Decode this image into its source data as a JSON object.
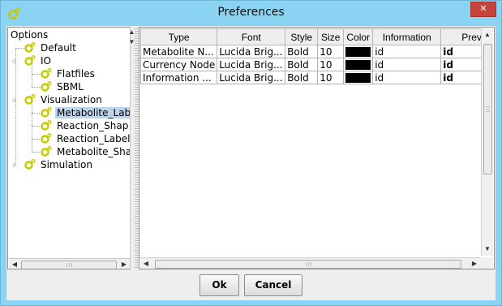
{
  "window": {
    "title": "Preferences",
    "close_label": "✕"
  },
  "tree": {
    "root": "Options",
    "items": [
      {
        "label": "Default"
      },
      {
        "label": "IO"
      },
      {
        "label": "Flatfiles"
      },
      {
        "label": "SBML"
      },
      {
        "label": "Visualization"
      },
      {
        "label": "Metabolite_Labe"
      },
      {
        "label": "Reaction_Shap"
      },
      {
        "label": "Reaction_Label"
      },
      {
        "label": "Metabolite_Sha"
      },
      {
        "label": "Simulation"
      }
    ]
  },
  "table": {
    "headers": [
      "Type",
      "Font",
      "Style",
      "Size",
      "Color",
      "Information",
      "Previe"
    ],
    "rows": [
      {
        "type": "Metabolite N...",
        "font": "Lucida Brig...",
        "style": "Bold",
        "size": "10",
        "color": "#000000",
        "information": "id",
        "preview": "id"
      },
      {
        "type": "Currency Node",
        "font": "Lucida Brig...",
        "style": "Bold",
        "size": "10",
        "color": "#000000",
        "information": "id",
        "preview": "id"
      },
      {
        "type": "Information ...",
        "font": "Lucida Brig...",
        "style": "Bold",
        "size": "10",
        "color": "#000000",
        "information": "id",
        "preview": "id"
      }
    ]
  },
  "buttons": {
    "ok": "Ok",
    "cancel": "Cancel"
  },
  "icons": {
    "app": "gear-icon",
    "tree_node": "gear-icon",
    "expanded": "collapse-handle-icon",
    "collapsed": "expand-handle-icon"
  },
  "colors": {
    "titlebar": "#8ad3f3",
    "selection": "#bcd4ec",
    "close": "#c7443d"
  }
}
